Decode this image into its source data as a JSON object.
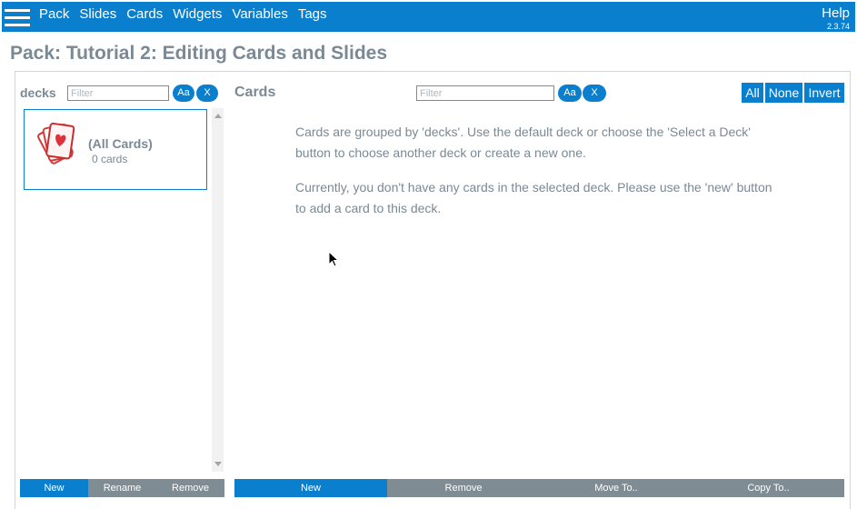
{
  "topbar": {
    "nav": [
      "Pack",
      "Slides",
      "Cards",
      "Widgets",
      "Variables",
      "Tags"
    ],
    "help_label": "Help",
    "version": "2.3.74"
  },
  "page_title": "Pack: Tutorial 2: Editing Cards and Slides",
  "decks": {
    "label": "decks",
    "filter_placeholder": "Filter",
    "case_toggle": "Aa",
    "clear": "X",
    "items": [
      {
        "name": "(All Cards)",
        "count": "0 cards"
      }
    ],
    "buttons": {
      "new": "New",
      "rename": "Rename",
      "remove": "Remove"
    }
  },
  "cards": {
    "label": "Cards",
    "filter_placeholder": "Filter",
    "case_toggle": "Aa",
    "clear": "X",
    "select": {
      "all": "All",
      "none": "None",
      "invert": "Invert"
    },
    "info": [
      "Cards are grouped by 'decks'. Use the default deck or choose the 'Select a Deck' button to choose another deck or create a new one.",
      "Currently, you don't have any cards in the selected deck. Please use the 'new' button to add a card to this deck."
    ],
    "buttons": {
      "new": "New",
      "remove": "Remove",
      "move": "Move To..",
      "copy": "Copy To.."
    }
  },
  "colors": {
    "accent": "#0a7fce",
    "muted_button": "#7f8c94",
    "text": "#7a8994"
  },
  "icons": {
    "menu": "hamburger-menu-icon",
    "deck": "playing-cards-icon",
    "cursor": "mouse-pointer-icon"
  }
}
